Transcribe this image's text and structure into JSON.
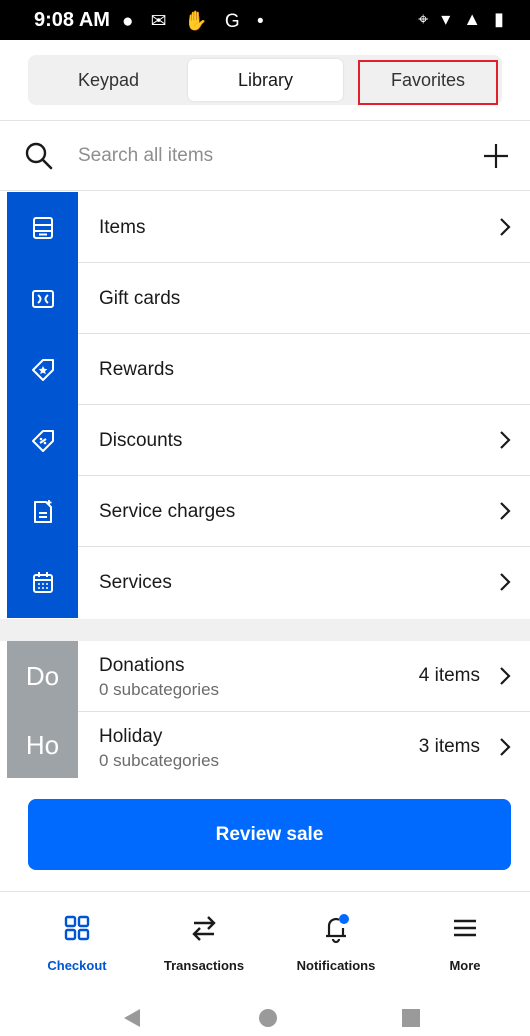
{
  "status_bar": {
    "time": "9:08 AM",
    "left_icons": "● ✉ ✋ G •",
    "right_icons": "⌖ ▾ ▲ ▮"
  },
  "tabs": [
    {
      "label": "Keypad"
    },
    {
      "label": "Library"
    },
    {
      "label": "Favorites"
    }
  ],
  "active_tab": "Library",
  "search": {
    "placeholder": "Search all items"
  },
  "library_items": [
    {
      "label": "Items",
      "icon": "items-icon",
      "chevron": true
    },
    {
      "label": "Gift cards",
      "icon": "gift-card-icon",
      "chevron": false
    },
    {
      "label": "Rewards",
      "icon": "rewards-icon",
      "chevron": false
    },
    {
      "label": "Discounts",
      "icon": "discounts-icon",
      "chevron": true
    },
    {
      "label": "Service charges",
      "icon": "service-charges-icon",
      "chevron": true
    },
    {
      "label": "Services",
      "icon": "services-icon",
      "chevron": true
    }
  ],
  "categories": [
    {
      "abbr": "Do",
      "name": "Donations",
      "subtitle": "0 subcategories",
      "count": "4 items"
    },
    {
      "abbr": "Ho",
      "name": "Holiday",
      "subtitle": "0 subcategories",
      "count": "3 items"
    }
  ],
  "review_button": {
    "label": "Review sale"
  },
  "bottom_nav": [
    {
      "label": "Checkout",
      "icon": "checkout-grid-icon"
    },
    {
      "label": "Transactions",
      "icon": "transactions-arrows-icon"
    },
    {
      "label": "Notifications",
      "icon": "bell-icon"
    },
    {
      "label": "More",
      "icon": "menu-icon"
    }
  ],
  "colors": {
    "brand_blue": "#0055d3",
    "button_blue": "#006aff",
    "category_gray": "#9ea3a8",
    "highlight_red": "#e0202a"
  }
}
